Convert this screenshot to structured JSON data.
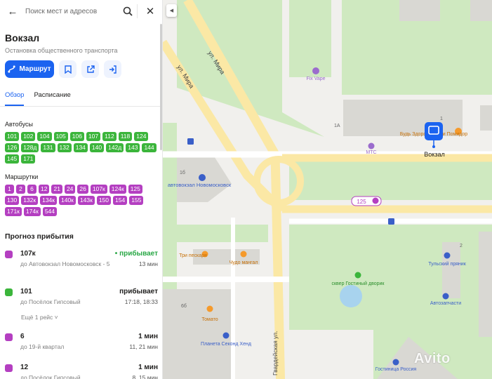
{
  "search": {
    "placeholder": "Поиск мест и адресов"
  },
  "stop": {
    "title": "Вокзал",
    "subtitle": "Остановка общественного транспорта"
  },
  "actions": {
    "route_label": "Маршрут"
  },
  "tabs": [
    "Обзор",
    "Расписание"
  ],
  "buses": {
    "label": "Автобусы",
    "routes": [
      "101",
      "102",
      "104",
      "105",
      "106",
      "107",
      "112",
      "118",
      "124",
      "126",
      "128д",
      "131",
      "132",
      "134",
      "140",
      "142д",
      "143",
      "144",
      "145",
      "171"
    ]
  },
  "minibuses": {
    "label": "Маршрутки",
    "routes": [
      "1",
      "2",
      "6",
      "12",
      "21",
      "24",
      "26",
      "107к",
      "124к",
      "125",
      "130",
      "132к",
      "134к",
      "140к",
      "143к",
      "150",
      "154",
      "155",
      "171к",
      "174к",
      "544"
    ]
  },
  "forecast": {
    "title": "Прогноз прибытия",
    "items": [
      {
        "route": "107к",
        "destination": "до Автовокзал Новомосковск - 5",
        "status": "прибывает",
        "times": "13 мин",
        "type": "minibus",
        "live": true
      },
      {
        "route": "101",
        "destination": "до Посёлок Гипсовый",
        "status": "прибывает",
        "times": "17:18, 18:33",
        "type": "bus",
        "live": false
      },
      {
        "route": "6",
        "destination": "до 19-й квартал",
        "status": "1 мин",
        "times": "11, 21 мин",
        "type": "minibus",
        "live": false
      },
      {
        "route": "12",
        "destination": "до Посёлок Гипсовый",
        "status": "1 мин",
        "times": "8, 15 мин",
        "type": "minibus",
        "live": false
      }
    ],
    "more_trips": "Ещё 1 рейс"
  },
  "map": {
    "streets": [
      "ул. Мира",
      "ул. Мира",
      "Гвардейская ул."
    ],
    "pois": [
      "Fix Vape",
      "Будь Здоров! Сыр и Помидор",
      "МТС",
      "Вокзал",
      "автовокзал Новомосковск",
      "Три пескаря",
      "Чудо мангал",
      "Тульский пряник",
      "сквер Гостиный дворик",
      "Автозапчасти",
      "Томато",
      "Планета Секонд Хенд",
      "Гостиница Россия"
    ],
    "house_numbers": [
      "1",
      "1А",
      "1б",
      "6б",
      "2"
    ],
    "route_badge": "125"
  },
  "watermark": "Avito",
  "colors": {
    "accent": "#1b63f0",
    "bus": "#3bb53b",
    "minibus": "#b43fc1"
  }
}
